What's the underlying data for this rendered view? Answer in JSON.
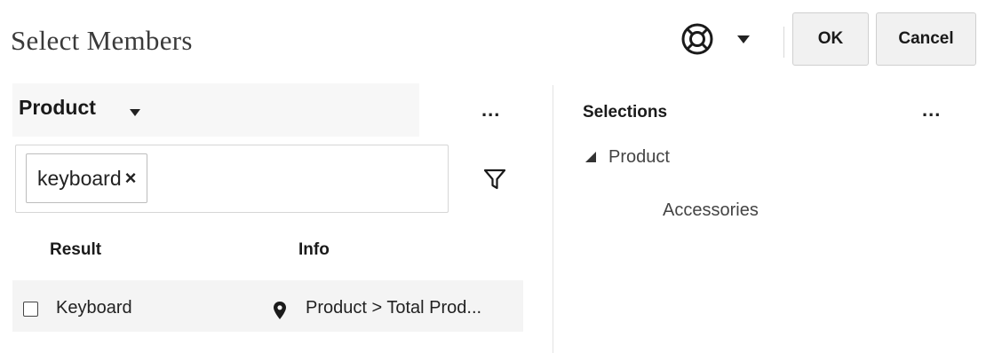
{
  "header": {
    "title": "Select Members",
    "help_icon": "lifebuoy-icon",
    "ok_label": "OK",
    "cancel_label": "Cancel"
  },
  "left_panel": {
    "dimension": "Product",
    "menu_label": "...",
    "search_chip": "keyboard",
    "chip_remove": "×",
    "filter_icon": "filter-funnel-icon",
    "columns": {
      "result": "Result",
      "info": "Info"
    },
    "results": [
      {
        "label": "Keyboard",
        "info": "Product > Total Prod...",
        "checked": false
      }
    ]
  },
  "right_panel": {
    "title": "Selections",
    "menu_label": "...",
    "tree": {
      "root": "Product",
      "children": [
        "Accessories"
      ]
    }
  }
}
